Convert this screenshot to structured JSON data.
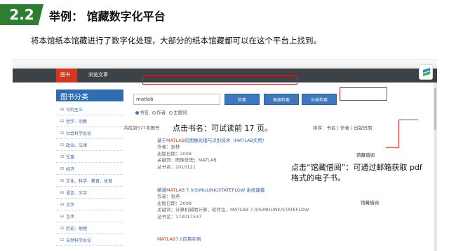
{
  "slide": {
    "section_number": "2.2",
    "section_title": "举例： 馆藏数字化平台",
    "intro": "将本馆纸本馆藏进行了数字化处理，大部分的纸本馆藏都可以在这个平台上找到。"
  },
  "site": {
    "nav": [
      "图书",
      "浏览文章"
    ],
    "sidebar_title": "图书分类",
    "sidebar_items": [
      "马列主义",
      "哲学、宗教",
      "社会科学总论",
      "政治、法律",
      "军事",
      "经济",
      "文化、科学、教育、体育",
      "语言、文字",
      "文学",
      "艺术",
      "历史、地理",
      "自然科学总论"
    ],
    "search_value": "matlab",
    "buttons": [
      "检索",
      "高级检索",
      "分类检索"
    ],
    "radio_options": [
      "书名",
      "作者",
      "主题词"
    ],
    "result_count": "共找到577本图书",
    "sort_bar": "排序：书名 | 作者 | 出版日期",
    "results": [
      {
        "title": "基于MATLAB的图像处理与识别技术（MATLAB实用）",
        "meta": [
          "作者：张林",
          "出版日期：2008",
          "关键词：图像处理；MATLAB",
          "丛书名：2010121"
        ],
        "link": "馆藏借阅"
      },
      {
        "title": "精通MATLAB 7.0/SIMULINK/STATEFLOW 系统建模",
        "meta": [
          "作者：张燕",
          "出版日期：2008",
          "关键词：计算机辅助计算，软件包，MATLAB 7.0/SIMULINK/STATEFLOW",
          "丛书名：173017537"
        ],
        "link": "馆藏借阅"
      },
      {
        "title": "MATLAB7.0应用实例",
        "meta": [],
        "link": ""
      }
    ]
  },
  "annotations": {
    "callout_title": "点击书名：可试读前 17 页。",
    "callout_borrow": "点击“馆藏借阅”：可通过邮箱获取 pdf 格式的电子书。"
  }
}
